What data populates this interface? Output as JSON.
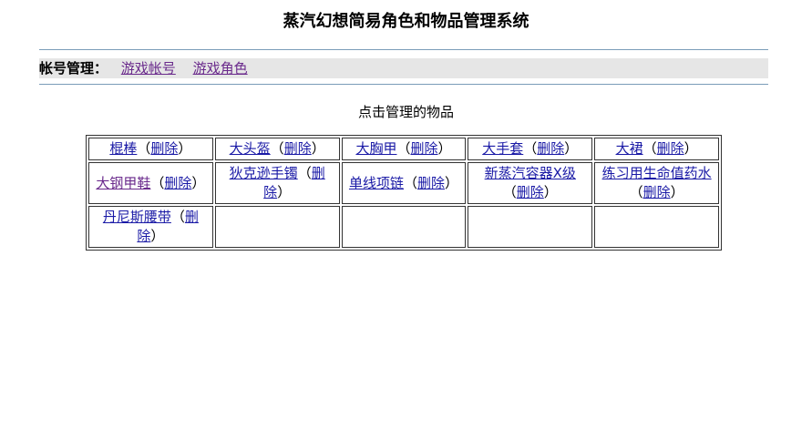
{
  "page": {
    "title": "蒸汽幻想简易角色和物品管理系统"
  },
  "nav": {
    "label": "帐号管理：",
    "links": [
      {
        "label": "游戏帐号"
      },
      {
        "label": "游戏角色"
      }
    ]
  },
  "main": {
    "subtitle": "点击管理的物品",
    "delete_label": "删除",
    "open_paren": "（",
    "close_paren": "）",
    "rows": [
      [
        {
          "name": "棍棒"
        },
        {
          "name": "大头盔"
        },
        {
          "name": "大胸甲"
        },
        {
          "name": "大手套"
        },
        {
          "name": "大裙"
        }
      ],
      [
        {
          "name": "大钢甲鞋"
        },
        {
          "name": "狄克逊手镯"
        },
        {
          "name": "单线项链"
        },
        {
          "name": "新蒸汽容器X级"
        },
        {
          "name": "练习用生命值药水"
        }
      ],
      [
        {
          "name": "丹尼斯腰带"
        },
        null,
        null,
        null,
        null
      ]
    ]
  }
}
